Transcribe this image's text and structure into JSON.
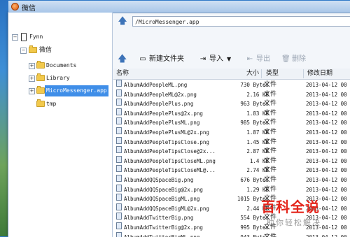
{
  "window": {
    "title": "微信"
  },
  "tree": {
    "device": "Fynn",
    "root_folder": "微信",
    "items": [
      "Documents",
      "Library",
      "MicroMessenger.app",
      "tmp"
    ]
  },
  "path": {
    "value": "/MicroMessenger.app"
  },
  "toolbar": {
    "new_folder": "新建文件夹",
    "import": "导入",
    "export": "导出",
    "delete": "删除"
  },
  "columns": {
    "name": "名称",
    "size": "大小",
    "type": "类型",
    "date": "修改日期"
  },
  "files": [
    {
      "name": "AlbumAddPeopleML.png",
      "size": "730 Bytes",
      "type": "文件",
      "date": "2013-04-12 00"
    },
    {
      "name": "AlbumAddPeopleML@2x.png",
      "size": "2.16 KB",
      "type": "文件",
      "date": "2013-04-12 00"
    },
    {
      "name": "AlbumAddPeoplePlus.png",
      "size": "963 Bytes",
      "type": "文件",
      "date": "2013-04-12 00"
    },
    {
      "name": "AlbumAddPeoplePlus@2x.png",
      "size": "1.83 KB",
      "type": "文件",
      "date": "2013-04-12 00"
    },
    {
      "name": "AlbumAddPeoplePlusML.png",
      "size": "985 Bytes",
      "type": "文件",
      "date": "2013-04-12 00"
    },
    {
      "name": "AlbumAddPeoplePlusML@2x.png",
      "size": "1.87 KB",
      "type": "文件",
      "date": "2013-04-12 00"
    },
    {
      "name": "AlbumAddPeopleTipsClose.png",
      "size": "1.45 KB",
      "type": "文件",
      "date": "2013-04-12 00"
    },
    {
      "name": "AlbumAddPeopleTipsClose@2x...",
      "size": "2.87 KB",
      "type": "文件",
      "date": "2013-04-12 00"
    },
    {
      "name": "AlbumAddPeopleTipsCloseML.png",
      "size": "1.4 KB",
      "type": "文件",
      "date": "2013-04-12 00"
    },
    {
      "name": "AlbumAddPeopleTipsCloseML@...",
      "size": "2.74 KB",
      "type": "文件",
      "date": "2013-04-12 00"
    },
    {
      "name": "AlbumAddQQSpaceBig.png",
      "size": "676 Bytes",
      "type": "文件",
      "date": "2013-04-12 00"
    },
    {
      "name": "AlbumAddQQSpaceBig@2x.png",
      "size": "1.29 KB",
      "type": "文件",
      "date": "2013-04-12 00"
    },
    {
      "name": "AlbumAddQQSpaceBigML.png",
      "size": "1015 Bytes",
      "type": "文件",
      "date": "2013-04-12 00"
    },
    {
      "name": "AlbumAddQQSpaceBigML@2x.png",
      "size": "2.44 KB",
      "type": "文件",
      "date": "2013-04-12 00"
    },
    {
      "name": "AlbumAddTwitterBig.png",
      "size": "554 Bytes",
      "type": "文件",
      "date": "2013-04-12 00"
    },
    {
      "name": "AlbumAddTwitterBig@2x.png",
      "size": "995 Bytes",
      "type": "文件",
      "date": "2013-04-12 00"
    },
    {
      "name": "AlbumAddTwitterBigML.png",
      "size": "943 Bytes",
      "type": "文件",
      "date": "2013-04-12 00"
    }
  ],
  "watermark": {
    "logo": "百科全说",
    "sub": "助你轻松解决"
  },
  "colors": {
    "selection": "#3f8ee8",
    "accent": "#3d73b8",
    "watermark": "#e4261c"
  }
}
